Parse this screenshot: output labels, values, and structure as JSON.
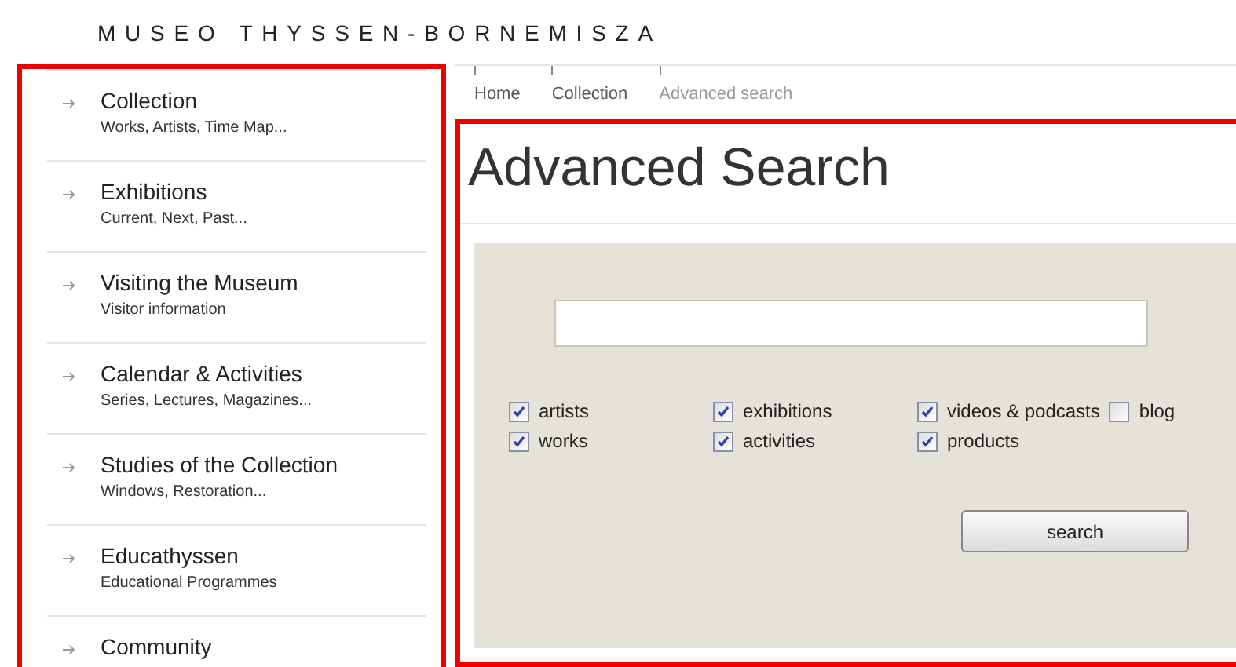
{
  "logo": "MUSEO THYSSEN-BORNEMISZA",
  "sidebar": {
    "items": [
      {
        "title": "Collection",
        "subtitle": "Works, Artists, Time Map..."
      },
      {
        "title": "Exhibitions",
        "subtitle": "Current, Next, Past..."
      },
      {
        "title": "Visiting the Museum",
        "subtitle": "Visitor information"
      },
      {
        "title": "Calendar & Activities",
        "subtitle": "Series, Lectures, Magazines..."
      },
      {
        "title": "Studies of the Collection",
        "subtitle": "Windows, Restoration..."
      },
      {
        "title": "Educathyssen",
        "subtitle": "Educational Programmes"
      },
      {
        "title": "Community"
      }
    ]
  },
  "breadcrumb": [
    {
      "label": "Home",
      "selected": false
    },
    {
      "label": "Collection",
      "selected": false
    },
    {
      "label": "Advanced search",
      "selected": true
    }
  ],
  "page_title": "Advanced Search",
  "search_form": {
    "options": [
      [
        {
          "label": "artists",
          "checked": true
        },
        {
          "label": "exhibitions",
          "checked": true
        },
        {
          "label": "videos & podcasts",
          "checked": true
        },
        {
          "label": "blog",
          "checked": false
        }
      ],
      [
        {
          "label": "works",
          "checked": true
        },
        {
          "label": "activities",
          "checked": true
        },
        {
          "label": "products",
          "checked": true
        }
      ]
    ],
    "button": "search"
  }
}
